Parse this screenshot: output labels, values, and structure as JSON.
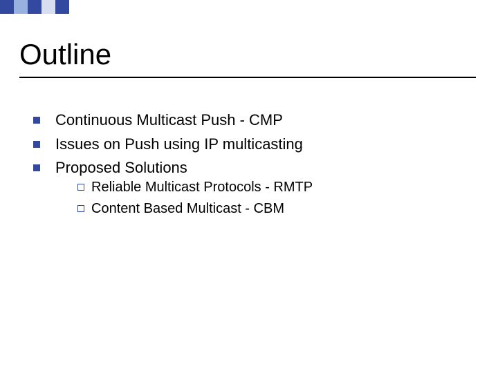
{
  "accent": {
    "colors": [
      "#33499f",
      "#99b1df",
      "#d6deef"
    ]
  },
  "title": "Outline",
  "bullets": [
    {
      "text": "Continuous Multicast Push - CMP"
    },
    {
      "text": "Issues on Push using IP multicasting"
    },
    {
      "text": "Proposed Solutions",
      "sub": [
        {
          "text": "Reliable Multicast Protocols - RMTP"
        },
        {
          "text": "Content Based Multicast - CBM"
        }
      ]
    }
  ]
}
